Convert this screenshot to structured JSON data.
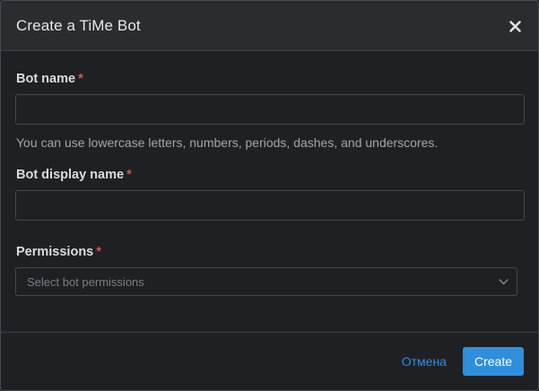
{
  "dialog": {
    "title": "Create a TiMe Bot",
    "close_glyph": "✕"
  },
  "fields": {
    "bot_name": {
      "label": "Bot name",
      "required_mark": "*",
      "value": "",
      "help": "You can use lowercase letters, numbers, periods, dashes, and underscores."
    },
    "display_name": {
      "label": "Bot display name",
      "required_mark": "*",
      "value": ""
    },
    "permissions": {
      "label": "Permissions",
      "required_mark": "*",
      "placeholder": "Select bot permissions",
      "icon": "chevron-down-icon"
    }
  },
  "footer": {
    "cancel_label": "Отмена",
    "create_label": "Create"
  },
  "colors": {
    "accent": "#2f8fdd",
    "required": "#e05050",
    "background": "#1f2024",
    "header_bg": "#2b2c30"
  }
}
